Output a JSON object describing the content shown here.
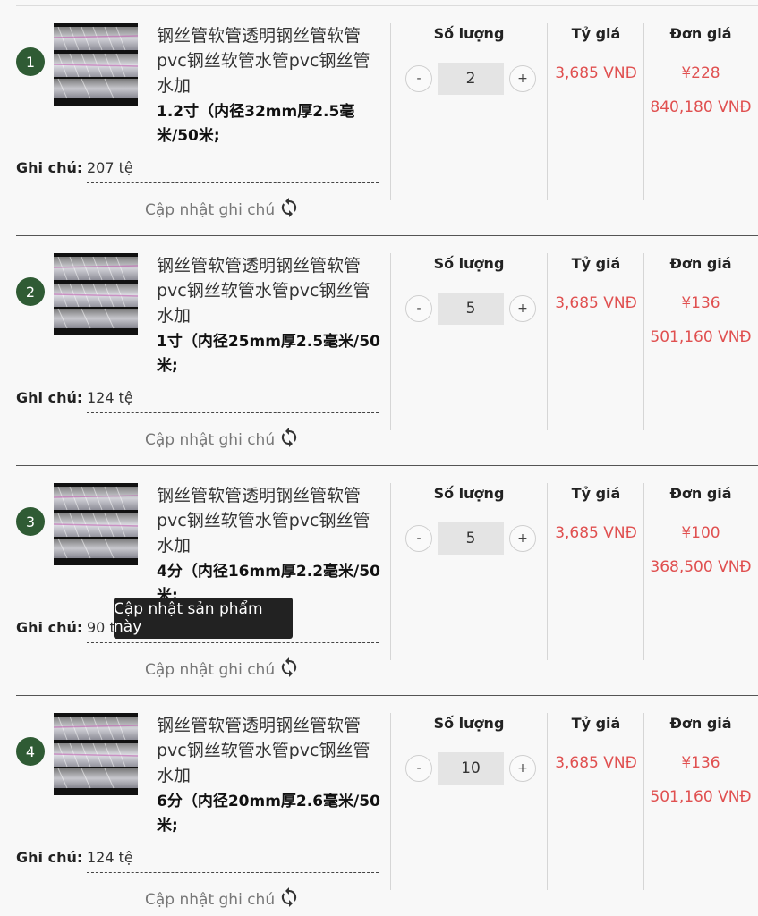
{
  "labels": {
    "quantity": "Số lượng",
    "exchange_rate": "Tỷ giá",
    "unit_price": "Đơn giá",
    "note": "Ghi chú:",
    "update_note": "Cập nhật ghi chú",
    "minus": "-",
    "plus": "+"
  },
  "tooltip": "Cập nhật sản phẩm này",
  "items": [
    {
      "index": "1",
      "name": "钢丝管软管透明钢丝管软管pvc钢丝软管水管pvc钢丝管水加",
      "variant": "1.2寸（内径32mm厚2.5毫米/50米;",
      "note": "207 tệ",
      "quantity": "2",
      "rate": "3,685 VNĐ",
      "price_cny": "¥228",
      "price_vnd": "840,180 VNĐ"
    },
    {
      "index": "2",
      "name": "钢丝管软管透明钢丝管软管pvc钢丝软管水管pvc钢丝管水加",
      "variant": "1寸（内径25mm厚2.5毫米/50米;",
      "note": "124 tệ",
      "quantity": "5",
      "rate": "3,685 VNĐ",
      "price_cny": "¥136",
      "price_vnd": "501,160 VNĐ"
    },
    {
      "index": "3",
      "name": "钢丝管软管透明钢丝管软管pvc钢丝软管水管pvc钢丝管水加",
      "variant": "4分（内径16mm厚2.2毫米/50米;",
      "note": "90 tệ",
      "quantity": "5",
      "rate": "3,685 VNĐ",
      "price_cny": "¥100",
      "price_vnd": "368,500 VNĐ"
    },
    {
      "index": "4",
      "name": "钢丝管软管透明钢丝管软管pvc钢丝软管水管pvc钢丝管水加",
      "variant": "6分（内径20mm厚2.6毫米/50米;",
      "note": "124 tệ",
      "quantity": "10",
      "rate": "3,685 VNĐ",
      "price_cny": "¥136",
      "price_vnd": "501,160 VNĐ"
    }
  ]
}
